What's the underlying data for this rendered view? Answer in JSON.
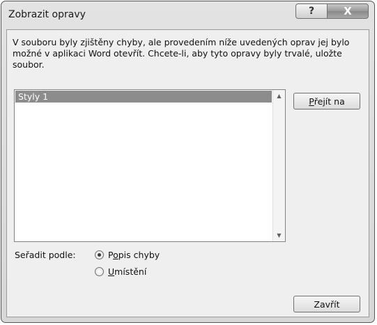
{
  "window": {
    "title": "Zobrazit opravy",
    "help_glyph": "?",
    "close_glyph": "X"
  },
  "message": "V souboru byly zjištěny chyby, ale provedením níže uvedených oprav jej bylo možné v aplikaci Word otevřít. Chcete-li, aby tyto opravy byly trvalé, uložte soubor.",
  "list": {
    "items": [
      "Styly 1"
    ],
    "selected_index": 0
  },
  "buttons": {
    "goto_prefix": "P",
    "goto_rest": "řejít na",
    "close_label": "Zavřít"
  },
  "sort": {
    "label": "Seřadit podle:",
    "option1_a": "P",
    "option1_u": "o",
    "option1_b": "pis chyby",
    "option2_u": "U",
    "option2_b": "místění",
    "selected": "Popis chyby"
  },
  "icons": [
    "help-icon",
    "close-icon",
    "scroll-up-arrow-icon",
    "scroll-down-arrow-icon"
  ]
}
